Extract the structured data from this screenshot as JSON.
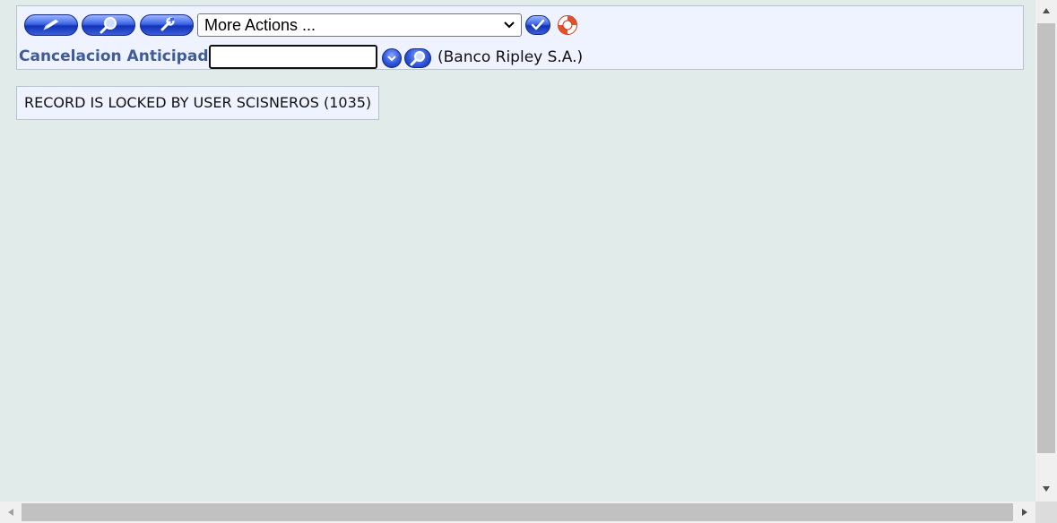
{
  "toolbar": {
    "more_actions_selected": "More Actions ...",
    "field_label": "Cancelacion Anticipada",
    "field_value": "",
    "bank_name": "(Banco Ripley S.A.)",
    "icons": {
      "edit": "pencil-icon",
      "search": "magnifier-icon",
      "tools": "wrench-icon",
      "confirm": "checkmark-icon",
      "help": "lifebuoy-icon",
      "dropdown": "chevron-down-icon",
      "lookup": "magnifier-icon"
    },
    "colors": {
      "button_blue": "#3d66e6",
      "label_blue": "#3f5b9a",
      "panel_bg": "#eef3ff",
      "page_bg": "#e1ebea"
    }
  },
  "message": {
    "lock_text": "RECORD IS LOCKED BY USER SCISNEROS (1035)"
  }
}
